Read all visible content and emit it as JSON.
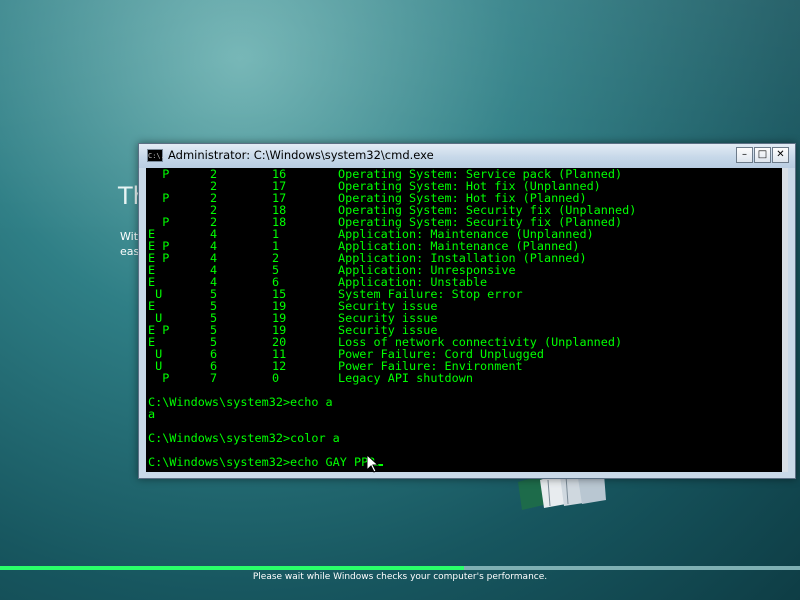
{
  "background": {
    "title": "Th",
    "text_line1": "Wit",
    "text_line2": "eas"
  },
  "window": {
    "title": "Administrator: C:\\Windows\\system32\\cmd.exe",
    "icon_label": "C:\\.",
    "controls": {
      "minimize": "–",
      "maximize": "□",
      "close": "✕"
    }
  },
  "console": {
    "text_color": "#00ff00",
    "rows": [
      {
        "flags": "  P",
        "a": "2",
        "b": "16",
        "desc": "Operating System: Service pack (Planned)"
      },
      {
        "flags": "",
        "a": "2",
        "b": "17",
        "desc": "Operating System: Hot fix (Unplanned)"
      },
      {
        "flags": "  P",
        "a": "2",
        "b": "17",
        "desc": "Operating System: Hot fix (Planned)"
      },
      {
        "flags": "",
        "a": "2",
        "b": "18",
        "desc": "Operating System: Security fix (Unplanned)"
      },
      {
        "flags": "  P",
        "a": "2",
        "b": "18",
        "desc": "Operating System: Security fix (Planned)"
      },
      {
        "flags": "E",
        "a": "4",
        "b": "1",
        "desc": "Application: Maintenance (Unplanned)"
      },
      {
        "flags": "E P",
        "a": "4",
        "b": "1",
        "desc": "Application: Maintenance (Planned)"
      },
      {
        "flags": "E P",
        "a": "4",
        "b": "2",
        "desc": "Application: Installation (Planned)"
      },
      {
        "flags": "E",
        "a": "4",
        "b": "5",
        "desc": "Application: Unresponsive"
      },
      {
        "flags": "E",
        "a": "4",
        "b": "6",
        "desc": "Application: Unstable"
      },
      {
        "flags": " U",
        "a": "5",
        "b": "15",
        "desc": "System Failure: Stop error"
      },
      {
        "flags": "E",
        "a": "5",
        "b": "19",
        "desc": "Security issue"
      },
      {
        "flags": " U",
        "a": "5",
        "b": "19",
        "desc": "Security issue"
      },
      {
        "flags": "E P",
        "a": "5",
        "b": "19",
        "desc": "Security issue"
      },
      {
        "flags": "E",
        "a": "5",
        "b": "20",
        "desc": "Loss of network connectivity (Unplanned)"
      },
      {
        "flags": " U",
        "a": "6",
        "b": "11",
        "desc": "Power Failure: Cord Unplugged"
      },
      {
        "flags": " U",
        "a": "6",
        "b": "12",
        "desc": "Power Failure: Environment"
      },
      {
        "flags": "  P",
        "a": "7",
        "b": "0",
        "desc": "Legacy API shutdown"
      }
    ],
    "lines_after": [
      "",
      "C:\\Windows\\system32>echo a",
      "a",
      "",
      "C:\\Windows\\system32>color a",
      ""
    ],
    "current_input": "C:\\Windows\\system32>echo GAY PPR"
  },
  "footer": {
    "progress_percent": 58,
    "progress_color": "#2aff6a",
    "status": "Please wait while Windows checks your computer's performance."
  }
}
